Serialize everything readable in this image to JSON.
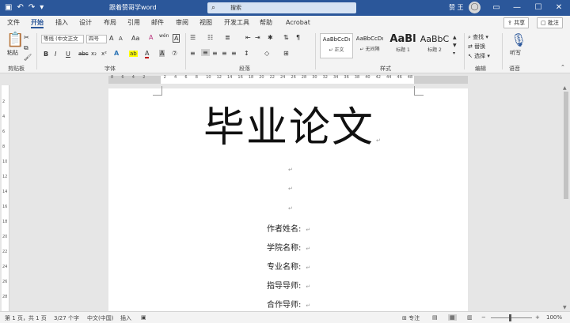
{
  "titlebar": {
    "doc_title": "跟着赞哥学word",
    "search_placeholder": "搜索",
    "user_name": "赞 王",
    "avatar_glyph": "◯",
    "qa_icons": [
      "save-icon",
      "undo-icon",
      "redo-icon",
      "customize-icon"
    ],
    "window_controls": [
      "ribbon-display-icon",
      "minimize-icon",
      "maximize-icon",
      "close-icon"
    ]
  },
  "tabs": {
    "items": [
      "文件",
      "开始",
      "插入",
      "设计",
      "布局",
      "引用",
      "邮件",
      "审阅",
      "视图",
      "开发工具",
      "帮助",
      "Acrobat"
    ],
    "active": "开始",
    "share_label": "共享",
    "comment_label": "批注"
  },
  "ribbon": {
    "clipboard": {
      "paste_label": "粘贴",
      "group_label": "剪贴板"
    },
    "font": {
      "font_name": "等线 (中文正文",
      "font_size": "四号",
      "grow_label": "A",
      "shrink_label": "A",
      "case_label": "Aa",
      "clear_format_glyph": "A",
      "wen_label": "wén",
      "char_border_label": "A",
      "bold": "B",
      "italic": "I",
      "underline": "U",
      "strike": "abc",
      "sub": "x₂",
      "sup": "x²",
      "effects": "A",
      "highlight": "ab",
      "font_color": "A",
      "shading": "A",
      "enclose": "⑦",
      "group_label": "字体"
    },
    "paragraph": {
      "group_label": "段落"
    },
    "styles": {
      "items": [
        {
          "preview": "AaBbCcDı",
          "name": "↵ 正文"
        },
        {
          "preview": "AaBbCcDı",
          "name": "↵ 无间隔"
        },
        {
          "preview": "AaBl",
          "name": "标题 1"
        },
        {
          "preview": "AaBbC",
          "name": "标题 2"
        }
      ],
      "group_label": "样式"
    },
    "editing": {
      "find": "查找",
      "replace": "替换",
      "select": "选择",
      "group_label": "编辑"
    },
    "voice": {
      "dictate": "听写",
      "group_label": "语音"
    }
  },
  "ruler": {
    "ticks": [
      "8",
      "6",
      "4",
      "2",
      "2",
      "4",
      "6",
      "8",
      "10",
      "12",
      "14",
      "16",
      "18",
      "20",
      "22",
      "24",
      "26",
      "28",
      "30",
      "32",
      "34",
      "36",
      "38",
      "40",
      "42",
      "44",
      "46",
      "48"
    ]
  },
  "vruler": {
    "ticks": [
      "2",
      "4",
      "6",
      "8",
      "10",
      "12",
      "14",
      "16",
      "18",
      "20",
      "22",
      "24",
      "26",
      "28"
    ]
  },
  "document": {
    "title": "毕业论文",
    "para_mark": "↵",
    "fields": [
      "作者姓名:",
      "学院名称:",
      "专业名称:",
      "指导导师:",
      "合作导师:"
    ]
  },
  "statusbar": {
    "page": "第 1 页，共 1 页",
    "words": "3/27 个字",
    "language": "中文(中国)",
    "mode": "插入",
    "focus": "专注",
    "zoom": "100%",
    "zoom_out": "−",
    "zoom_in": "+"
  }
}
